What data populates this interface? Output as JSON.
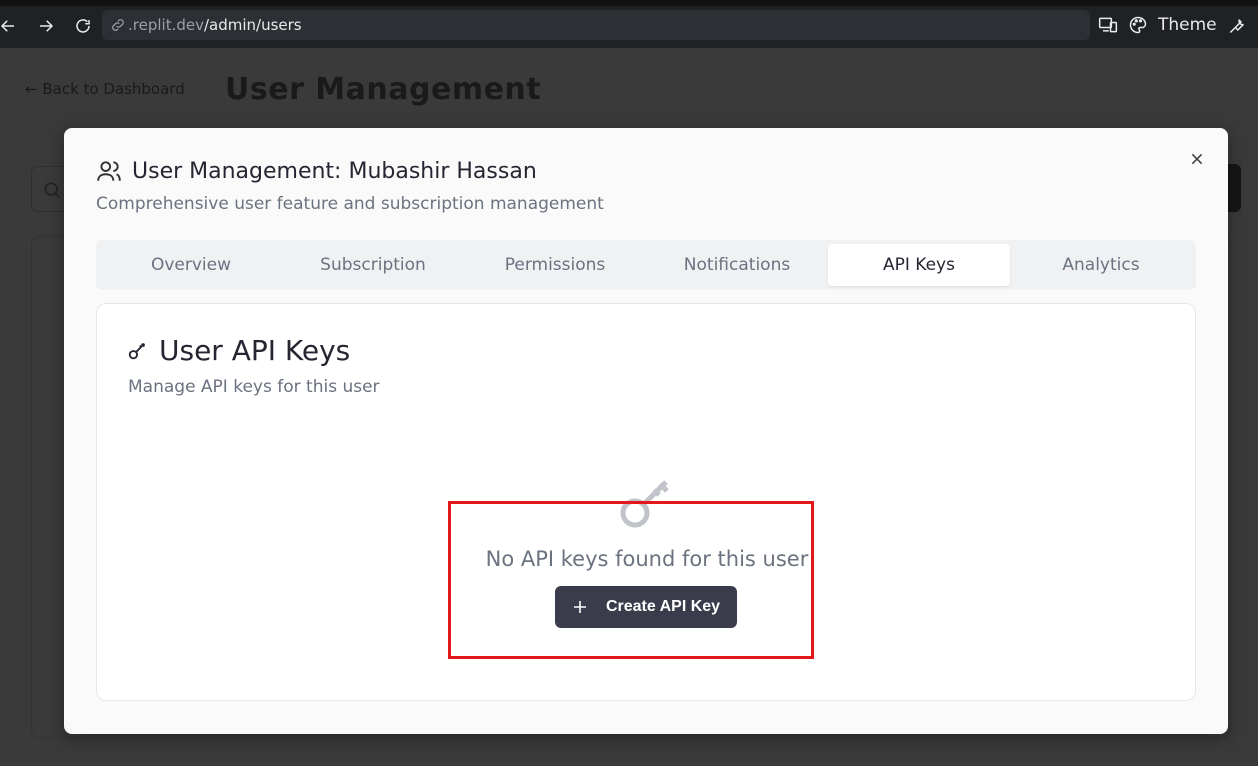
{
  "browser": {
    "url_domain": ".replit.dev",
    "url_path": "/admin/users",
    "theme_label": "Theme"
  },
  "page": {
    "back_link": "← Back to Dashboard",
    "title": "User Management"
  },
  "modal": {
    "title": "User Management: Mubashir Hassan",
    "description": "Comprehensive user feature and subscription management",
    "tabs": [
      {
        "label": "Overview"
      },
      {
        "label": "Subscription"
      },
      {
        "label": "Permissions"
      },
      {
        "label": "Notifications"
      },
      {
        "label": "API Keys",
        "active": true
      },
      {
        "label": "Analytics"
      }
    ],
    "card": {
      "title": "User API Keys",
      "description": "Manage API keys for this user",
      "empty_text": "No API keys found for this user",
      "create_button": "Create API Key"
    }
  },
  "colors": {
    "primary_button": "#3a3b4b",
    "highlight": "#e4181b",
    "modal_bg": "#fafafa"
  }
}
